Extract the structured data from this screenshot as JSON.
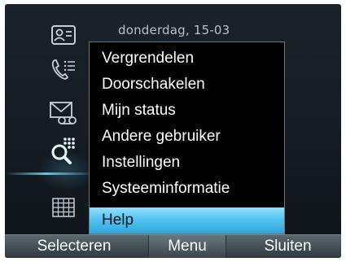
{
  "status": {
    "date": "donderdag, 15-03"
  },
  "sidebar": {
    "icons": [
      "contacts-icon",
      "call-log-icon",
      "voicemail-icon",
      "dialpad-search-icon",
      "calendar-grid-icon"
    ],
    "active_icon": "dialpad-search-icon"
  },
  "menu": {
    "items": [
      "Vergrendelen",
      "Doorschakelen",
      "Mijn status",
      "Andere gebruiker",
      "Instellingen",
      "Systeeminformatie",
      "Help"
    ],
    "selected": "Help"
  },
  "softkeys": {
    "left": "Selecteren",
    "middle": "Menu",
    "right": "Sluiten"
  },
  "colors": {
    "highlight": "#56c4f0",
    "background": "#141b21",
    "menu_background": "#000000"
  }
}
